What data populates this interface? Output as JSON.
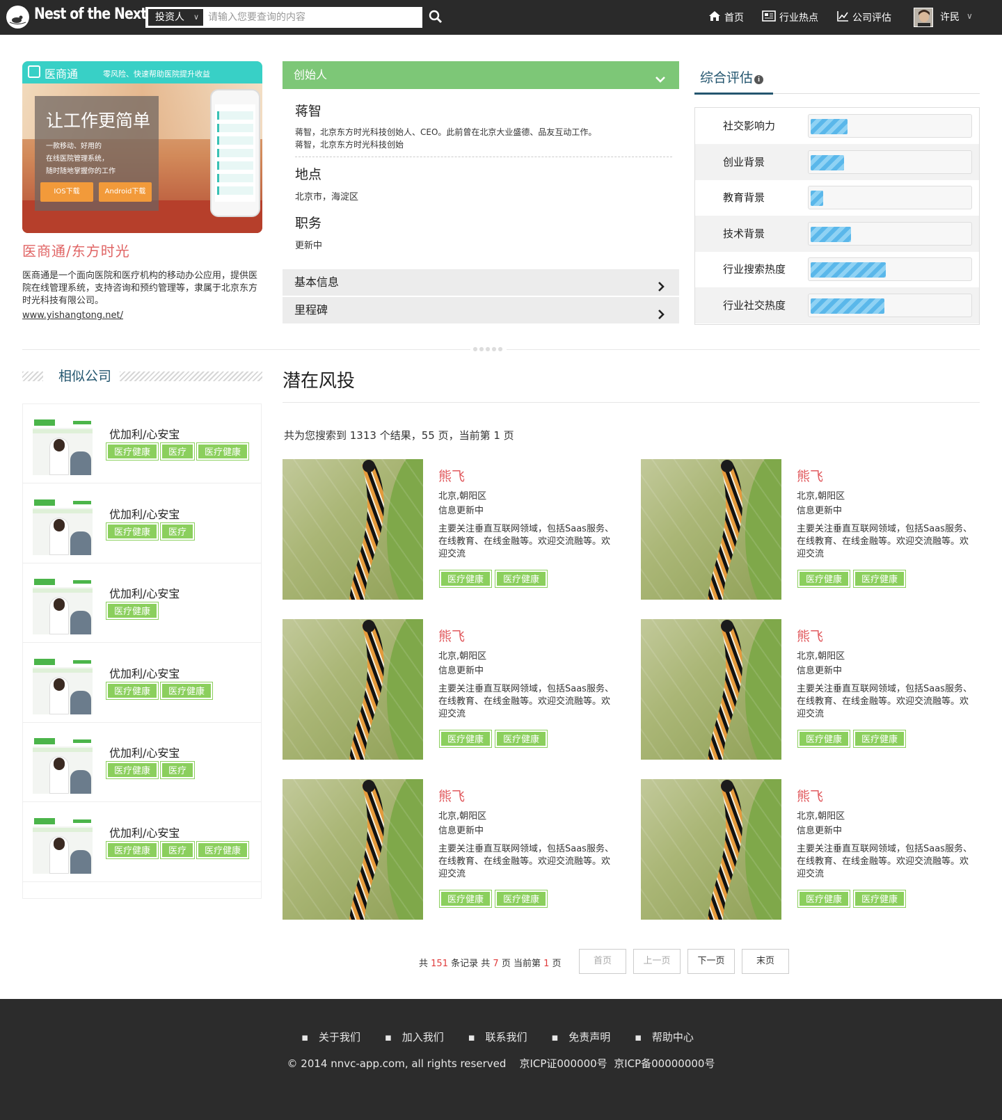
{
  "header": {
    "logo_text": "Nest of the Next",
    "search_category": "投资人",
    "search_placeholder": "请输入您要查询的内容",
    "nav": [
      {
        "label": "首页",
        "icon": "home-icon"
      },
      {
        "label": "行业热点",
        "icon": "newspaper-icon"
      },
      {
        "label": "公司评估",
        "icon": "chart-icon"
      }
    ],
    "user_name": "许民"
  },
  "product": {
    "banner": {
      "title": "医商通",
      "subtitle": "零风险、快速帮助医院提升收益",
      "headline": "让工作更简单",
      "lines": [
        "一款移动、好用的",
        "在线医院管理系统，",
        "随时随地掌握你的工作"
      ],
      "btn_ios": "IOS下载",
      "btn_android": "Android下载"
    },
    "name": "医商通/东方时光",
    "description": "医商通是一个面向医院和医疗机构的移动办公应用，提供医院在线管理系统，支持咨询和预约管理等，隶属于北京东方时光科技有限公司。",
    "url": "www.yishangtong.net/"
  },
  "founder": {
    "section_label": "创始人",
    "name": "蒋智",
    "desc_line1": "蒋智，北京东方时光科技创始人、CEO。此前曾在北京大业盛德、品友互动工作。",
    "desc_line2": "蒋智，北京东方时光科技创始",
    "location_label": "地点",
    "location": "北京市，海淀区",
    "position_label": "职务",
    "position": "更新中",
    "basic_info": "基本信息",
    "milestones": "里程碑"
  },
  "evaluation": {
    "title": "综合评估",
    "info_icon": "i",
    "rows": [
      {
        "label": "社交影响力",
        "value": 0.23
      },
      {
        "label": "创业背景",
        "value": 0.21
      },
      {
        "label": "教育背景",
        "value": 0.08
      },
      {
        "label": "技术背景",
        "value": 0.25
      },
      {
        "label": "行业搜索热度",
        "value": 0.47
      },
      {
        "label": "行业社交热度",
        "value": 0.46
      }
    ]
  },
  "similar": {
    "title": "相似公司",
    "items": [
      {
        "name": "优加利/心安宝",
        "tags": [
          "医疗健康",
          "医疗",
          "医疗健康"
        ]
      },
      {
        "name": "优加利/心安宝",
        "tags": [
          "医疗健康",
          "医疗"
        ]
      },
      {
        "name": "优加利/心安宝",
        "tags": [
          "医疗健康"
        ]
      },
      {
        "name": "优加利/心安宝",
        "tags": [
          "医疗健康",
          "医疗健康"
        ]
      },
      {
        "name": "优加利/心安宝",
        "tags": [
          "医疗健康",
          "医疗"
        ]
      },
      {
        "name": "优加利/心安宝",
        "tags": [
          "医疗健康",
          "医疗",
          "医疗健康"
        ]
      }
    ]
  },
  "investors": {
    "title": "潜在风投",
    "count_text": "共为您搜索到 1313 个结果，55 页，当前第 1 页",
    "cards": [
      {
        "name": "熊飞",
        "location": "北京,朝阳区",
        "status": "信息更新中",
        "desc": "主要关注垂直互联网领域，包括Saas服务、在线教育、在线金融等。欢迎交流融等。欢迎交流",
        "tags": [
          "医疗健康",
          "医疗健康"
        ]
      },
      {
        "name": "熊飞",
        "location": "北京,朝阳区",
        "status": "信息更新中",
        "desc": "主要关注垂直互联网领域，包括Saas服务、在线教育、在线金融等。欢迎交流融等。欢迎交流",
        "tags": [
          "医疗健康",
          "医疗健康"
        ]
      },
      {
        "name": "熊飞",
        "location": "北京,朝阳区",
        "status": "信息更新中",
        "desc": "主要关注垂直互联网领域，包括Saas服务、在线教育、在线金融等。欢迎交流融等。欢迎交流",
        "tags": [
          "医疗健康",
          "医疗健康"
        ]
      },
      {
        "name": "熊飞",
        "location": "北京,朝阳区",
        "status": "信息更新中",
        "desc": "主要关注垂直互联网领域，包括Saas服务、在线教育、在线金融等。欢迎交流融等。欢迎交流",
        "tags": [
          "医疗健康",
          "医疗健康"
        ]
      },
      {
        "name": "熊飞",
        "location": "北京,朝阳区",
        "status": "信息更新中",
        "desc": "主要关注垂直互联网领域，包括Saas服务、在线教育、在线金融等。欢迎交流融等。欢迎交流",
        "tags": [
          "医疗健康",
          "医疗健康"
        ]
      },
      {
        "name": "熊飞",
        "location": "北京,朝阳区",
        "status": "信息更新中",
        "desc": "主要关注垂直互联网领域，包括Saas服务、在线教育、在线金融等。欢迎交流融等。欢迎交流",
        "tags": [
          "医疗健康",
          "医疗健康"
        ]
      }
    ]
  },
  "pagination": {
    "prefix": "共",
    "total_records": "151",
    "mid1": "条记录 共",
    "total_pages": "7",
    "mid2": "页 当前第",
    "current": "1",
    "suffix": "页",
    "first": "首页",
    "prev": "上一页",
    "next": "下一页",
    "last": "末页"
  },
  "footer": {
    "links": [
      "关于我们",
      "加入我们",
      "联系我们",
      "免责声明",
      "帮助中心"
    ],
    "copyright": "© 2014 nnvc-app.com, all rights reserved    京ICP证000000号  京ICP备00000000号"
  },
  "colors": {
    "topbar": "#2a2a2a",
    "founder_green": "#7dc777",
    "tag_green": "#8bcf5d",
    "accent_red": "#e0585c",
    "heading_blue": "#24566f",
    "bar_blue": "#5ab7ea"
  }
}
